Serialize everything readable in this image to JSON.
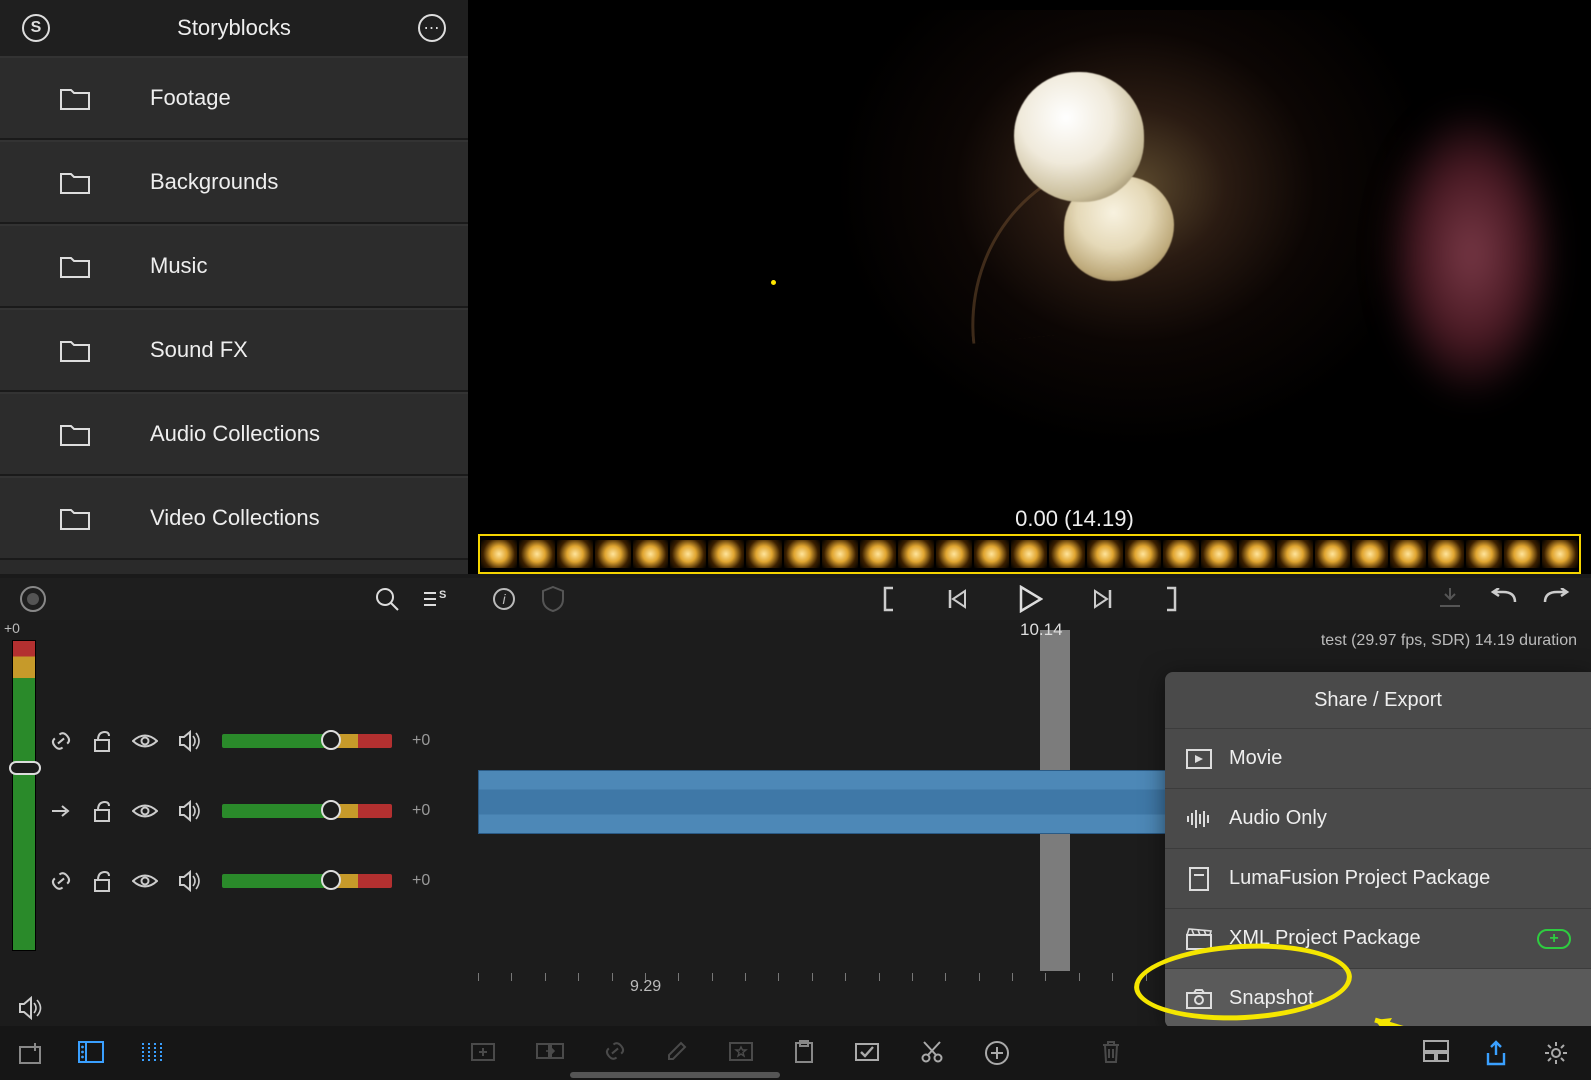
{
  "sidebar": {
    "title": "Storyblocks",
    "items": [
      {
        "label": "Footage"
      },
      {
        "label": "Backgrounds"
      },
      {
        "label": "Music"
      },
      {
        "label": "Sound FX"
      },
      {
        "label": "Audio Collections"
      },
      {
        "label": "Video Collections"
      }
    ]
  },
  "preview": {
    "time_display": "0.00  (14.19)"
  },
  "timeline": {
    "zero_label": "+0",
    "playhead_time": "10.14",
    "play_zone_label": "9.29",
    "project_info": "test (29.97 fps, SDR)  14.19 duration",
    "tracks": [
      {
        "gain": "+0"
      },
      {
        "gain": "+0"
      },
      {
        "gain": "+0"
      }
    ]
  },
  "popover": {
    "title": "Share / Export",
    "items": [
      {
        "label": "Movie",
        "icon": "movie"
      },
      {
        "label": "Audio Only",
        "icon": "audio"
      },
      {
        "label": "LumaFusion Project Package",
        "icon": "package"
      },
      {
        "label": "XML Project Package",
        "icon": "xml",
        "badge": "plus"
      },
      {
        "label": "Snapshot",
        "icon": "snapshot",
        "highlight": true
      }
    ]
  },
  "colors": {
    "accent_blue": "#3aa0ff",
    "annotation_yellow": "#f5e600",
    "badge_green": "#2ecc40"
  }
}
